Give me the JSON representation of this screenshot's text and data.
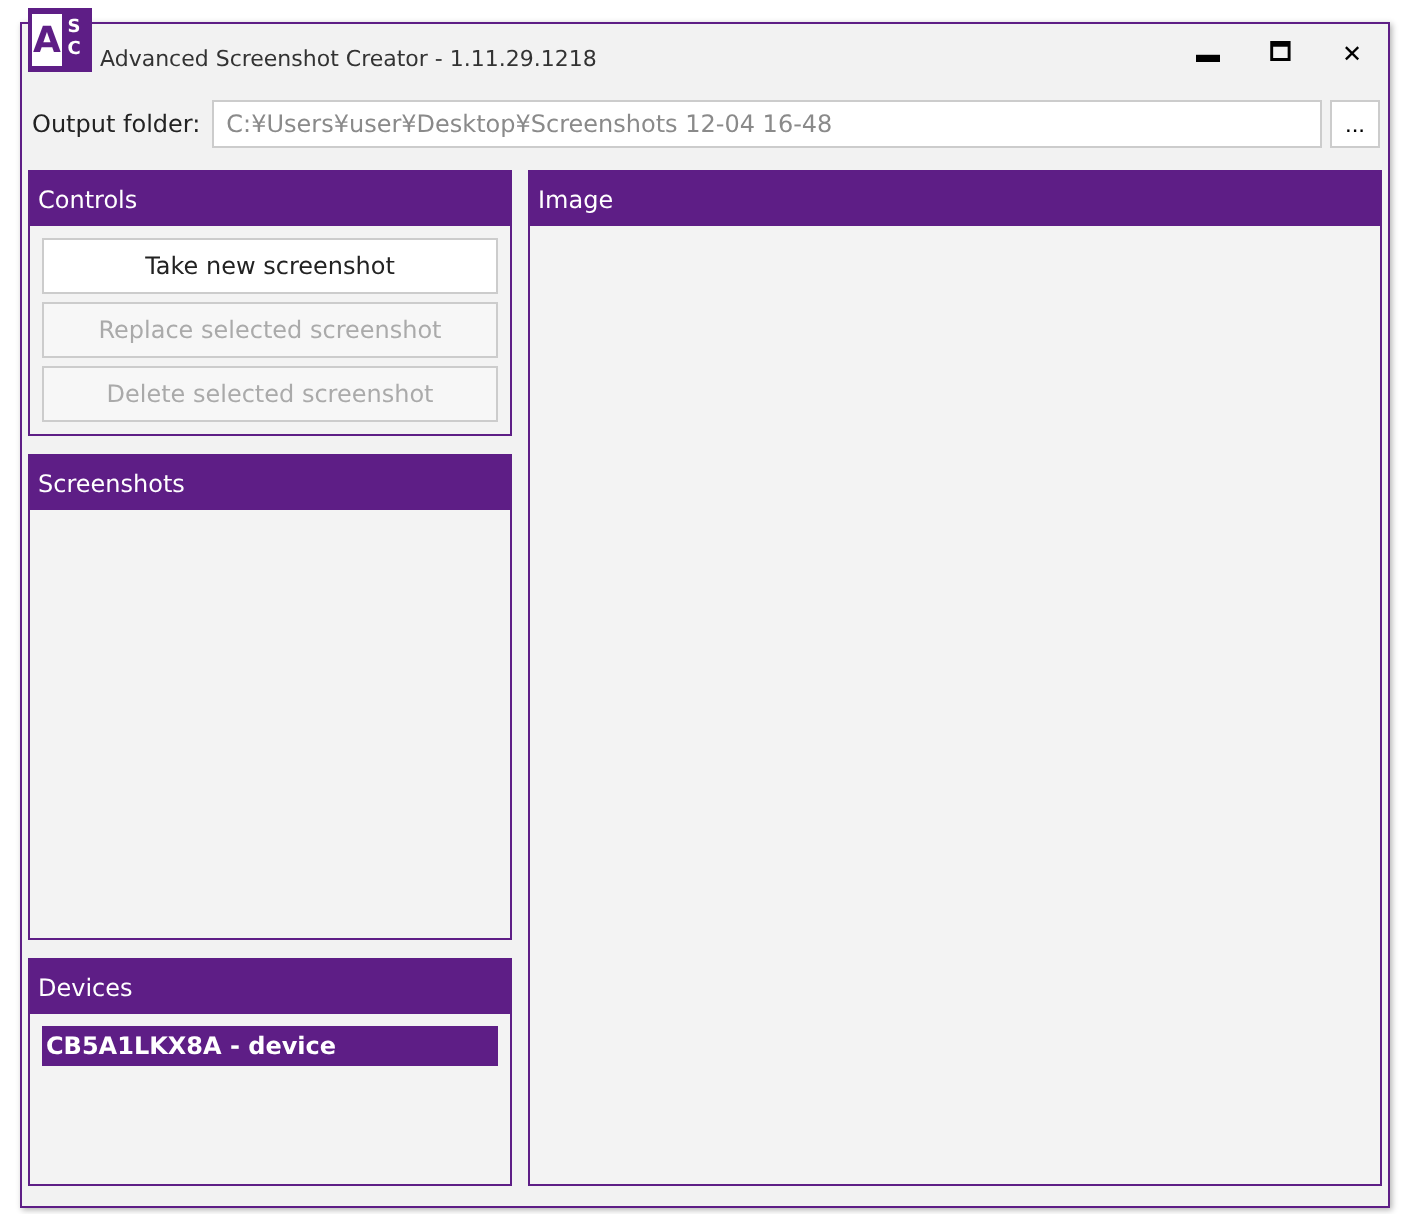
{
  "window": {
    "title": "Advanced Screenshot Creator - 1.11.29.1218",
    "logo": {
      "top": "A",
      "letters": [
        "S",
        "C"
      ]
    },
    "controls": [
      "▬",
      "🗖",
      "✕"
    ]
  },
  "output_folder": {
    "label": "Output folder:",
    "value": "C:¥Users¥user¥Desktop¥Screenshots 12-04 16-48",
    "browse": "..."
  },
  "controls_panel": {
    "title": "Controls",
    "buttons": [
      {
        "label": "Take new screenshot",
        "disabled": false
      },
      {
        "label": "Replace selected screenshot",
        "disabled": true
      },
      {
        "label": "Delete selected screenshot",
        "disabled": true
      }
    ]
  },
  "screenshots_panel": {
    "title": "Screenshots"
  },
  "devices_panel": {
    "title": "Devices",
    "items": [
      {
        "label": "CB5A1LKX8A - device",
        "selected": true
      }
    ]
  },
  "image_panel": {
    "title": "Image"
  }
}
